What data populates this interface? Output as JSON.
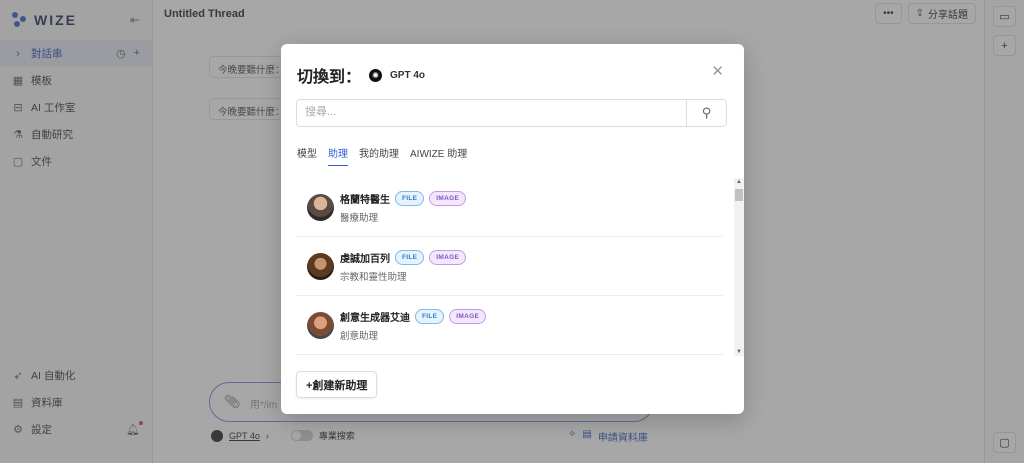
{
  "sidebar": {
    "logo": "WIZE",
    "items": [
      {
        "label": "對話串"
      },
      {
        "label": "模板"
      },
      {
        "label": "AI 工作室"
      },
      {
        "label": "自動研究"
      },
      {
        "label": "文件"
      }
    ],
    "bottom_items": [
      {
        "label": "AI 自動化"
      },
      {
        "label": "資料庫"
      },
      {
        "label": "設定"
      }
    ]
  },
  "header": {
    "title": "Untitled Thread",
    "more_label": "•••",
    "share_label": "分享話題"
  },
  "background": {
    "chip_1": "今晚要聽什麼：",
    "chip_2": "今晚要聽什麼：",
    "composer_placeholder": "用*/im",
    "model_label": "GPT 4o",
    "pro_search_label": "專業搜索",
    "kb_label": "申請資料庫"
  },
  "modal": {
    "title": "切換到：",
    "current_model": "GPT 4o",
    "search_placeholder": "搜尋...",
    "tabs": [
      {
        "label": "模型"
      },
      {
        "label": "助理"
      },
      {
        "label": "我的助理"
      },
      {
        "label": "AIWIZE 助理"
      }
    ],
    "assistants": [
      {
        "name": "格蘭特醫生",
        "desc": "醫療助理",
        "file_badge": "FILE",
        "image_badge": "IMAGE"
      },
      {
        "name": "虔誠加百列",
        "desc": "宗教和靈性助理",
        "file_badge": "FILE",
        "image_badge": "IMAGE"
      },
      {
        "name": "創意生成器艾迪",
        "desc": "創意助理",
        "file_badge": "FILE",
        "image_badge": "IMAGE"
      }
    ],
    "create_label": "+創建新助理"
  }
}
